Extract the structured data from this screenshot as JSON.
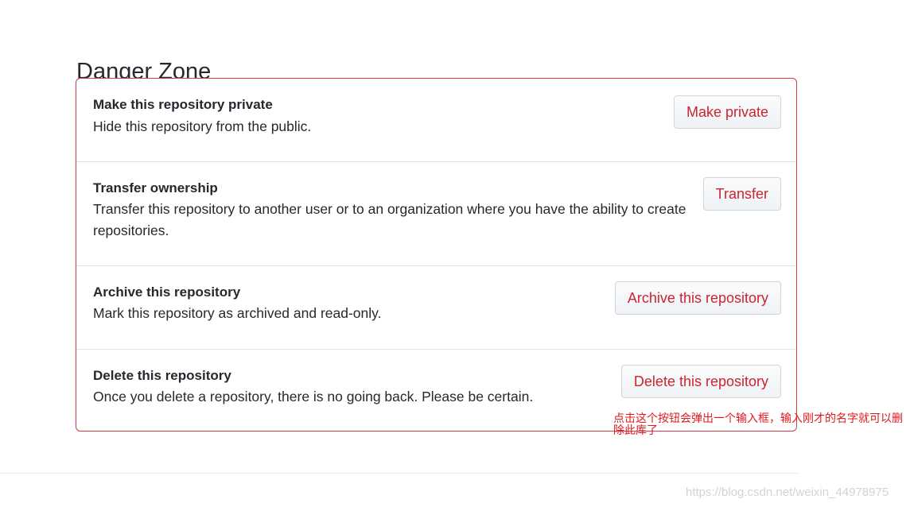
{
  "section": {
    "title": "Danger Zone"
  },
  "rows": [
    {
      "title": "Make this repository private",
      "description": "Hide this repository from the public.",
      "button_label": "Make private"
    },
    {
      "title": "Transfer ownership",
      "description": "Transfer this repository to another user or to an organization where you have the ability to create repositories.",
      "button_label": "Transfer"
    },
    {
      "title": "Archive this repository",
      "description": "Mark this repository as archived and read-only.",
      "button_label": "Archive this repository"
    },
    {
      "title": "Delete this repository",
      "description": "Once you delete a repository, there is no going back. Please be certain.",
      "button_label": "Delete this repository"
    }
  ],
  "annotation": {
    "text": "点击这个按钮会弹出一个输入框，输入刚才的名字就可以删除此库了"
  },
  "watermark": {
    "text": "https://blog.csdn.net/weixin_44978975"
  },
  "colors": {
    "danger": "#cb2431",
    "border": "#d73a49",
    "annotation": "#e0191e"
  }
}
